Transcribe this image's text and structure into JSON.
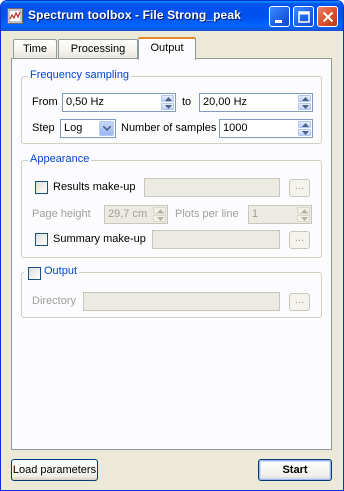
{
  "window": {
    "title": "Spectrum toolbox - File Strong_peak"
  },
  "tabs": [
    {
      "label": "Time"
    },
    {
      "label": "Processing"
    },
    {
      "label": "Output"
    }
  ],
  "frequency_sampling": {
    "legend": "Frequency sampling",
    "from_label": "From",
    "from_value": "0,50 Hz",
    "to_label": "to",
    "to_value": "20,00 Hz",
    "step_label": "Step",
    "step_value": "Log",
    "samples_label": "Number of samples",
    "samples_value": "1000"
  },
  "appearance": {
    "legend": "Appearance",
    "results_label": "Results make-up",
    "page_height_label": "Page height",
    "page_height_value": "29,7 cm",
    "plots_label": "Plots per line",
    "plots_value": "1",
    "summary_label": "Summary make-up",
    "browse_label": "..."
  },
  "output": {
    "legend": "Output",
    "directory_label": "Directory",
    "browse_label": "..."
  },
  "buttons": {
    "load": "Load parameters",
    "start": "Start"
  },
  "colors": {
    "group_legend": "#0046d5",
    "titlebar": "#0053ee",
    "active_tab_accent": "#e68b2c"
  }
}
